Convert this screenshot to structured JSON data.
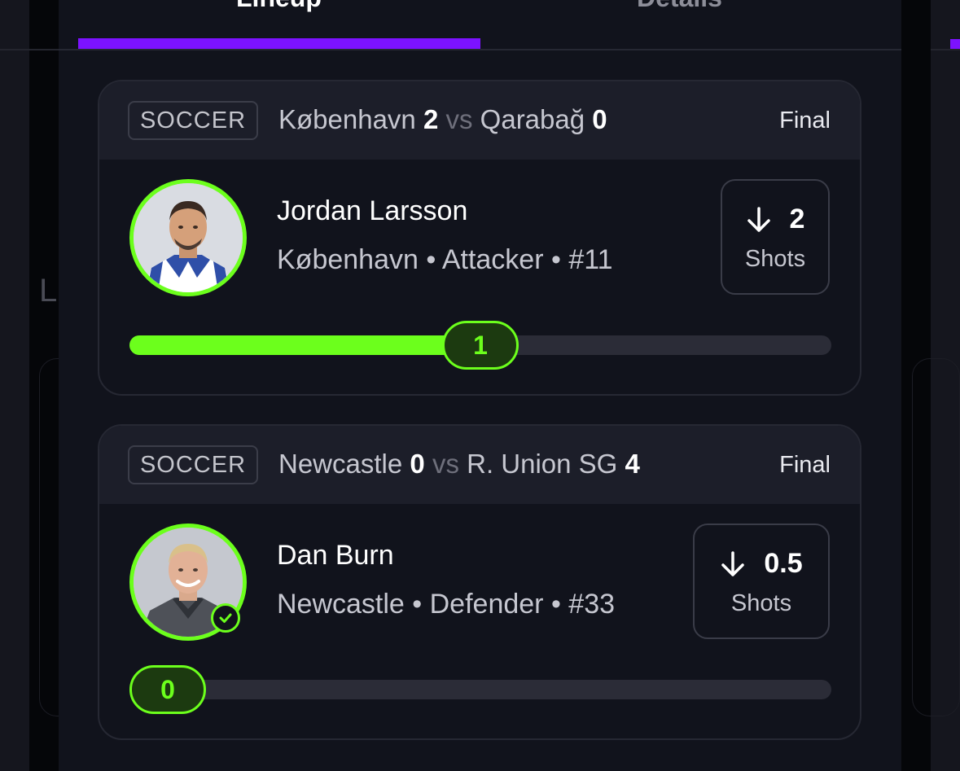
{
  "tabs": [
    {
      "label": "Lineup",
      "active": true
    },
    {
      "label": "Details",
      "active": false
    }
  ],
  "background": {
    "fragment_text": "L"
  },
  "colors": {
    "accent_purple": "#7c12ff",
    "accent_green": "#6cff1c",
    "sheet_bg": "#11131c",
    "header_bg": "#1c1e29"
  },
  "cards": [
    {
      "sport": "SOCCER",
      "home_team": "København",
      "home_score": "2",
      "vs": "vs",
      "away_team": "Qarabağ",
      "away_score": "0",
      "status": "Final",
      "player_name": "Jordan Larsson",
      "player_meta": "København • Attacker • #11",
      "line_icon": "arrow-down-icon",
      "line_value": "2",
      "line_stat": "Shots",
      "result_value": "1",
      "progress_fraction": 0.5,
      "verified": false
    },
    {
      "sport": "SOCCER",
      "home_team": "Newcastle",
      "home_score": "0",
      "vs": "vs",
      "away_team": "R. Union SG",
      "away_score": "4",
      "status": "Final",
      "player_name": "Dan Burn",
      "player_meta": "Newcastle • Defender • #33",
      "line_icon": "arrow-down-icon",
      "line_value": "0.5",
      "line_stat": "Shots",
      "result_value": "0",
      "progress_fraction": 0,
      "verified": true
    }
  ]
}
